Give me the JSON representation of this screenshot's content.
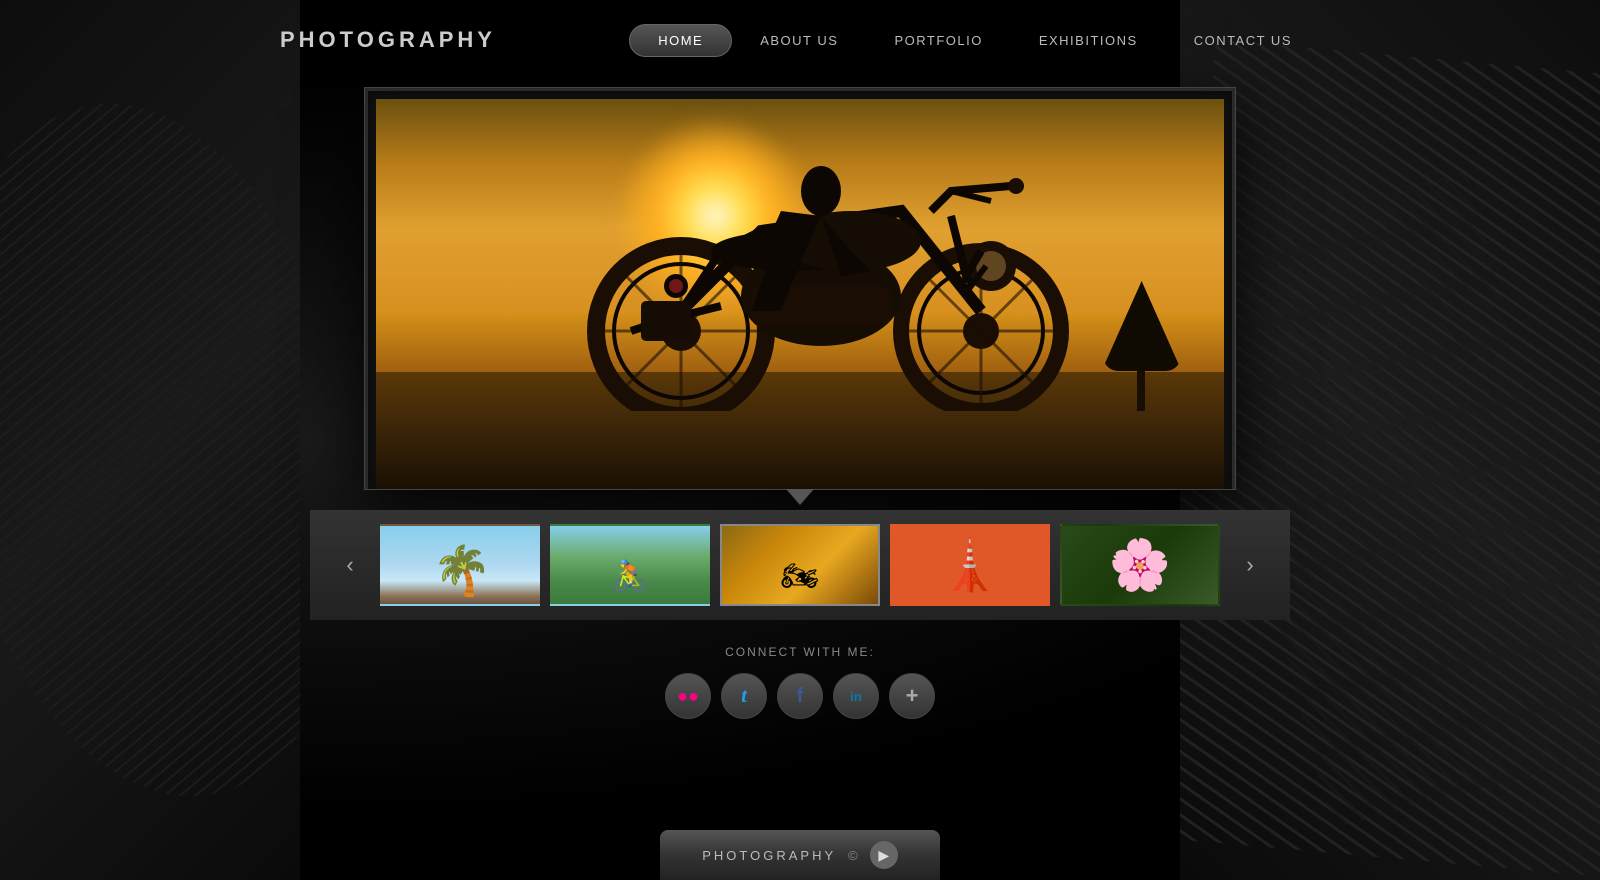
{
  "site": {
    "logo": "PHOTOGRAPHY",
    "background_color": "#0a0a0a"
  },
  "nav": {
    "items": [
      {
        "id": "home",
        "label": "HOME",
        "active": true
      },
      {
        "id": "about",
        "label": "ABOUT US",
        "active": false
      },
      {
        "id": "portfolio",
        "label": "PORTFOLIO",
        "active": false
      },
      {
        "id": "exhibitions",
        "label": "EXHIBITIONS",
        "active": false
      },
      {
        "id": "contact",
        "label": "CONTACT US",
        "active": false
      }
    ]
  },
  "slideshow": {
    "current_index": 2,
    "slides": [
      {
        "id": 1,
        "title": "Palm Trees",
        "description": "Tropical palm trees against blue sky"
      },
      {
        "id": 2,
        "title": "Cyclist",
        "description": "Cyclist on a green road"
      },
      {
        "id": 3,
        "title": "Motorcycle Sunset",
        "description": "Motorcycle silhouette at golden sunset"
      },
      {
        "id": 4,
        "title": "Tower",
        "description": "Tower on orange background"
      },
      {
        "id": 5,
        "title": "Pink Flowers",
        "description": "Pink flowers close-up"
      }
    ]
  },
  "connect": {
    "label": "CONNECT WITH ME:",
    "social": [
      {
        "id": "flickr",
        "label": "Flickr",
        "icon": "f•"
      },
      {
        "id": "twitter",
        "label": "Twitter",
        "icon": "t"
      },
      {
        "id": "facebook",
        "label": "Facebook",
        "icon": "f"
      },
      {
        "id": "linkedin",
        "label": "LinkedIn",
        "icon": "in"
      },
      {
        "id": "plus",
        "label": "More",
        "icon": "+"
      }
    ]
  },
  "footer": {
    "label": "PHOTOGRAPHY",
    "copyright_icon": "©"
  },
  "nav_prev_label": "‹",
  "nav_next_label": "›"
}
